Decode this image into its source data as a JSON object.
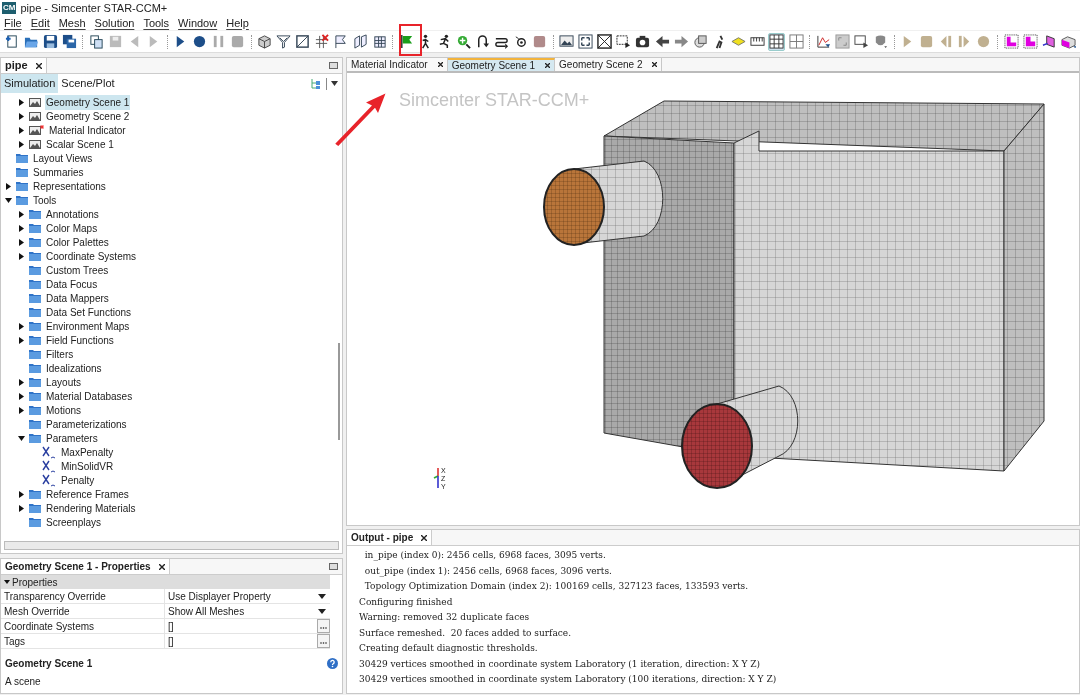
{
  "window": {
    "title": "pipe - Simcenter STAR-CCM+",
    "app_badge": "CM"
  },
  "menu": [
    "File",
    "Edit",
    "Mesh",
    "Solution",
    "Tools",
    "Window",
    "Help"
  ],
  "view_toggles": [
    {
      "selected": true
    },
    {
      "selected": false
    }
  ],
  "left_panel": {
    "tab": "pipe",
    "subtabs": [
      {
        "label": "Simulation",
        "selected": true
      },
      {
        "label": "Scene/Plot",
        "selected": false
      }
    ]
  },
  "tree": {
    "continued": [
      {
        "label": "Geometry Scene 1",
        "kind": "scene",
        "expanded": false,
        "selected": true
      },
      {
        "label": "Geometry Scene 2",
        "kind": "scene",
        "expanded": false,
        "selected": false
      },
      {
        "label": "Material Indicator",
        "kind": "scene-modified",
        "expanded": false,
        "selected": false
      },
      {
        "label": "Scalar Scene 1",
        "kind": "scene",
        "expanded": false,
        "selected": false
      }
    ],
    "items": [
      {
        "label": "Layout Views",
        "kind": "folder",
        "selected": false
      },
      {
        "label": "Summaries",
        "kind": "folder",
        "selected": false
      },
      {
        "label": "Representations",
        "kind": "folder",
        "expanded": false,
        "selected": false
      },
      {
        "label": "Tools",
        "kind": "folder",
        "expanded": true,
        "selected": false,
        "children": [
          {
            "label": "Annotations",
            "kind": "folder",
            "expanded": false,
            "selected": false
          },
          {
            "label": "Color Maps",
            "kind": "folder",
            "expanded": false,
            "selected": false
          },
          {
            "label": "Color Palettes",
            "kind": "folder",
            "expanded": false,
            "selected": false
          },
          {
            "label": "Coordinate Systems",
            "kind": "folder",
            "expanded": false,
            "selected": false
          },
          {
            "label": "Custom Trees",
            "kind": "folder",
            "selected": false
          },
          {
            "label": "Data Focus",
            "kind": "folder",
            "selected": false
          },
          {
            "label": "Data Mappers",
            "kind": "folder",
            "selected": false
          },
          {
            "label": "Data Set Functions",
            "kind": "folder",
            "selected": false
          },
          {
            "label": "Environment Maps",
            "kind": "folder",
            "expanded": false,
            "selected": false
          },
          {
            "label": "Field Functions",
            "kind": "folder",
            "expanded": false,
            "selected": false
          },
          {
            "label": "Filters",
            "kind": "folder",
            "selected": false
          },
          {
            "label": "Idealizations",
            "kind": "folder",
            "selected": false
          },
          {
            "label": "Layouts",
            "kind": "folder",
            "expanded": false,
            "selected": false
          },
          {
            "label": "Material Databases",
            "kind": "folder",
            "expanded": false,
            "selected": false
          },
          {
            "label": "Motions",
            "kind": "folder",
            "expanded": false,
            "selected": false
          },
          {
            "label": "Parameterizations",
            "kind": "folder",
            "selected": false
          },
          {
            "label": "Parameters",
            "kind": "folder",
            "expanded": true,
            "selected": false,
            "children": [
              {
                "label": "MaxPenalty",
                "kind": "parameter",
                "selected": false
              },
              {
                "label": "MinSolidVR",
                "kind": "parameter",
                "selected": false
              },
              {
                "label": "Penalty",
                "kind": "parameter",
                "selected": false
              }
            ]
          },
          {
            "label": "Reference Frames",
            "kind": "folder",
            "expanded": false,
            "selected": false
          },
          {
            "label": "Rendering Materials",
            "kind": "folder",
            "expanded": false,
            "selected": false
          },
          {
            "label": "Screenplays",
            "kind": "folder",
            "selected": false
          }
        ]
      }
    ]
  },
  "properties": {
    "tab": "Geometry Scene 1 - Properties",
    "group": "Properties",
    "group_expanded": true,
    "rows": [
      {
        "name": "Transparency Override",
        "value": "Use Displayer Property",
        "kind": "dropdown"
      },
      {
        "name": "Mesh Override",
        "value": "Show All Meshes",
        "kind": "dropdown"
      },
      {
        "name": "Coordinate Systems",
        "value": "[]",
        "kind": "editor"
      },
      {
        "name": "Tags",
        "value": "[]",
        "kind": "editor"
      }
    ],
    "description_title": "Geometry Scene 1",
    "description": "A scene"
  },
  "scene_tabs": [
    {
      "label": "Material Indicator",
      "selected": false
    },
    {
      "label": "Geometry Scene 1",
      "selected": true
    },
    {
      "label": "Geometry Scene 2",
      "selected": false
    }
  ],
  "viewport": {
    "logo_text": "Simcenter STAR-CCM+",
    "triad": [
      "X",
      "Z",
      "Y"
    ]
  },
  "output": {
    "tab": "Output - pipe",
    "lines": [
      "  in_pipe (index 0): 2456 cells, 6968 faces, 3095 verts.",
      "  out_pipe (index 1): 2456 cells, 6968 faces, 3096 verts.",
      "  Topology Optimization Domain (index 2): 100169 cells, 327123 faces, 133593 verts.",
      "Configuring finished",
      "Warning: removed 32 duplicate faces",
      "Surface remeshed.  20 faces added to surface.",
      "Creating default diagnostic thresholds.",
      "30429 vertices smoothed in coordinate system Laboratory (1 iteration, direction: X Y Z)",
      "30429 vertices smoothed in coordinate system Laboratory (100 iterations, direction: X Y Z)"
    ]
  }
}
